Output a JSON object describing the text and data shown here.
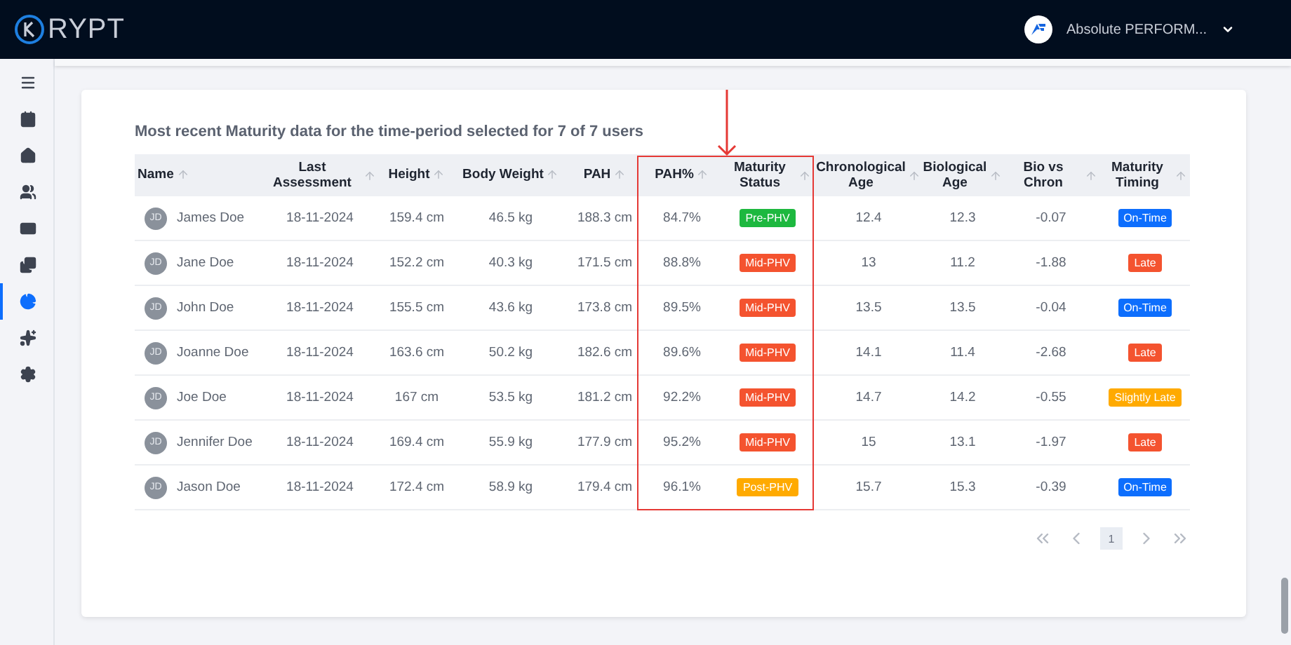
{
  "header": {
    "logo_text": "RYPT",
    "account": "Absolute PERFORM..."
  },
  "sidebar": {
    "items": [
      {
        "selected": false
      },
      {
        "selected": false
      },
      {
        "selected": false
      },
      {
        "selected": false
      },
      {
        "selected": false
      },
      {
        "selected": false
      },
      {
        "selected": true
      },
      {
        "selected": false
      },
      {
        "selected": false
      }
    ]
  },
  "card": {
    "title": "Most recent Maturity data for the time-period selected for 7 of 7 users",
    "table": {
      "columns": [
        "Name",
        "Last Assessment",
        "Height",
        "Body Weight",
        "PAH",
        "PAH%",
        "Maturity Status",
        "Chronological Age",
        "Biological Age",
        "Bio vs Chron",
        "Maturity Timing"
      ],
      "rows": [
        {
          "initials": "JD",
          "name": "James Doe",
          "last_assessment": "18-11-2024",
          "height": "159.4 cm",
          "body_weight": "46.5 kg",
          "pah": "188.3 cm",
          "pah_pct": "84.7%",
          "status": {
            "label": "Pre-PHV",
            "color": "#1db83f"
          },
          "chron_age": "12.4",
          "bio_age": "12.3",
          "bio_vs_chron": "-0.07",
          "timing": {
            "label": "On-Time",
            "color": "#0d6efd"
          }
        },
        {
          "initials": "JD",
          "name": "Jane Doe",
          "last_assessment": "18-11-2024",
          "height": "152.2 cm",
          "body_weight": "40.3 kg",
          "pah": "171.5 cm",
          "pah_pct": "88.8%",
          "status": {
            "label": "Mid-PHV",
            "color": "#f4532f"
          },
          "chron_age": "13",
          "bio_age": "11.2",
          "bio_vs_chron": "-1.88",
          "timing": {
            "label": "Late",
            "color": "#f4532f"
          }
        },
        {
          "initials": "JD",
          "name": "John Doe",
          "last_assessment": "18-11-2024",
          "height": "155.5 cm",
          "body_weight": "43.6 kg",
          "pah": "173.8 cm",
          "pah_pct": "89.5%",
          "status": {
            "label": "Mid-PHV",
            "color": "#f4532f"
          },
          "chron_age": "13.5",
          "bio_age": "13.5",
          "bio_vs_chron": "-0.04",
          "timing": {
            "label": "On-Time",
            "color": "#0d6efd"
          }
        },
        {
          "initials": "JD",
          "name": "Joanne Doe",
          "last_assessment": "18-11-2024",
          "height": "163.6 cm",
          "body_weight": "50.2 kg",
          "pah": "182.6 cm",
          "pah_pct": "89.6%",
          "status": {
            "label": "Mid-PHV",
            "color": "#f4532f"
          },
          "chron_age": "14.1",
          "bio_age": "11.4",
          "bio_vs_chron": "-2.68",
          "timing": {
            "label": "Late",
            "color": "#f4532f"
          }
        },
        {
          "initials": "JD",
          "name": "Joe Doe",
          "last_assessment": "18-11-2024",
          "height": "167 cm",
          "body_weight": "53.5 kg",
          "pah": "181.2 cm",
          "pah_pct": "92.2%",
          "status": {
            "label": "Mid-PHV",
            "color": "#f4532f"
          },
          "chron_age": "14.7",
          "bio_age": "14.2",
          "bio_vs_chron": "-0.55",
          "timing": {
            "label": "Slightly Late",
            "color": "#ffaa00"
          }
        },
        {
          "initials": "JD",
          "name": "Jennifer Doe",
          "last_assessment": "18-11-2024",
          "height": "169.4 cm",
          "body_weight": "55.9 kg",
          "pah": "177.9 cm",
          "pah_pct": "95.2%",
          "status": {
            "label": "Mid-PHV",
            "color": "#f4532f"
          },
          "chron_age": "15",
          "bio_age": "13.1",
          "bio_vs_chron": "-1.97",
          "timing": {
            "label": "Late",
            "color": "#f4532f"
          }
        },
        {
          "initials": "JD",
          "name": "Jason Doe",
          "last_assessment": "18-11-2024",
          "height": "172.4 cm",
          "body_weight": "58.9 kg",
          "pah": "179.4 cm",
          "pah_pct": "96.1%",
          "status": {
            "label": "Post-PHV",
            "color": "#ffaa00"
          },
          "chron_age": "15.7",
          "bio_age": "15.3",
          "bio_vs_chron": "-0.39",
          "timing": {
            "label": "On-Time",
            "color": "#0d6efd"
          }
        }
      ]
    },
    "pagination": {
      "pages": [
        {
          "label": "1",
          "selected": true
        }
      ]
    }
  }
}
